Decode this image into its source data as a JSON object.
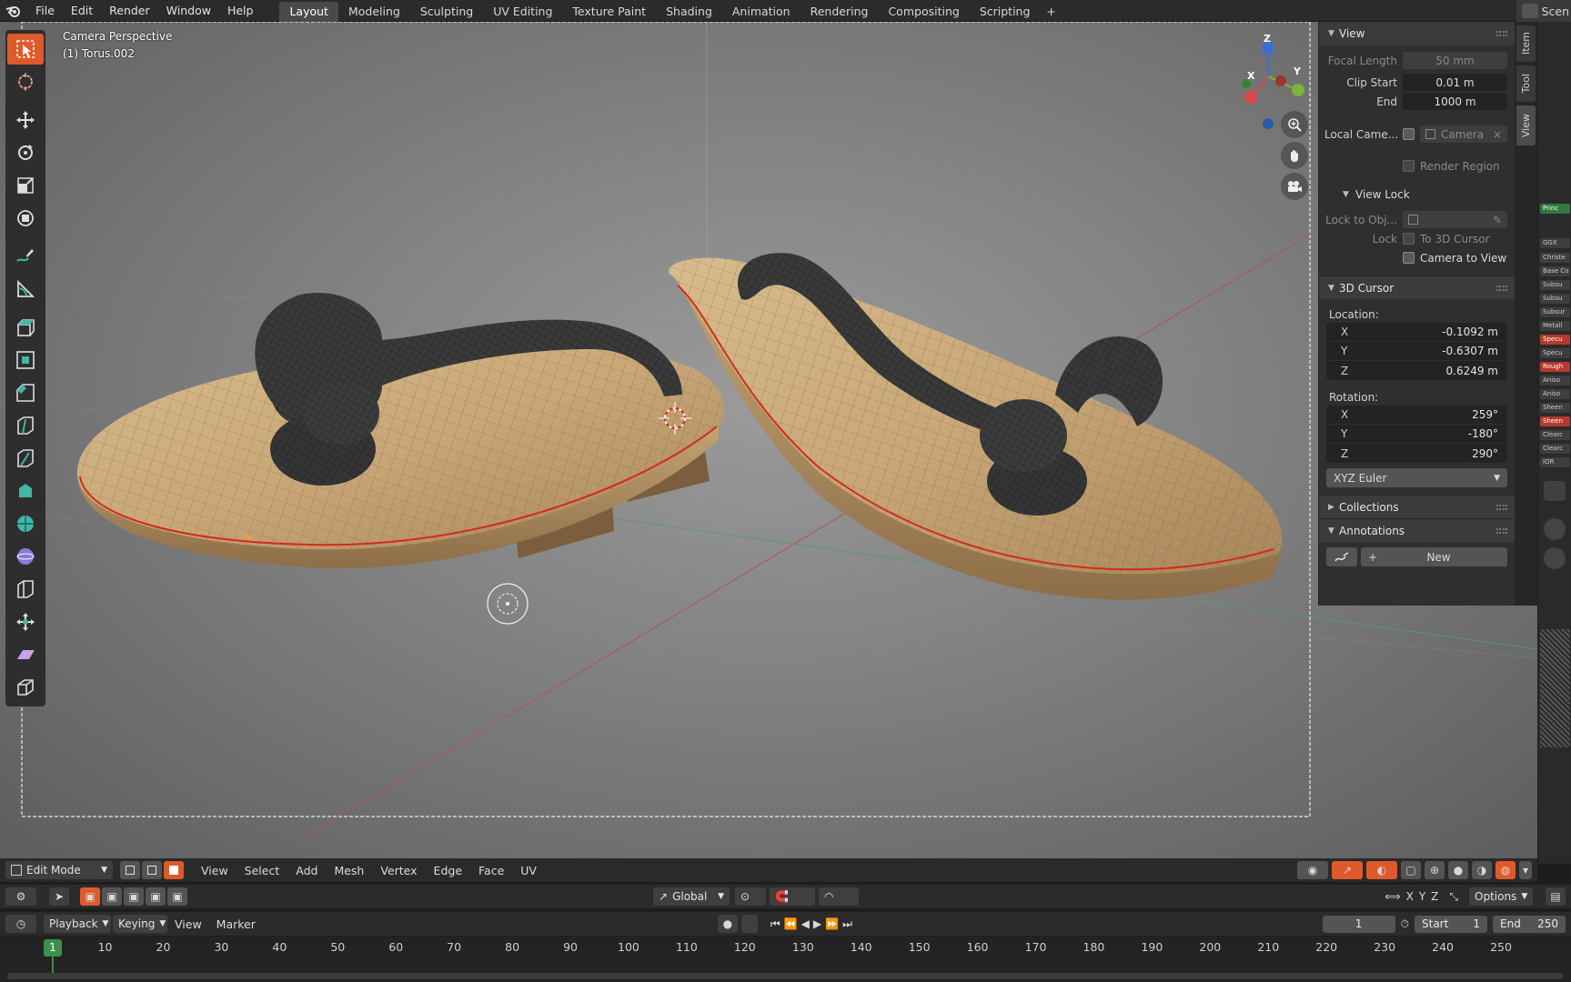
{
  "topbar": {
    "menus": [
      "File",
      "Edit",
      "Render",
      "Window",
      "Help"
    ],
    "workspaces": [
      "Layout",
      "Modeling",
      "Sculpting",
      "UV Editing",
      "Texture Paint",
      "Shading",
      "Animation",
      "Rendering",
      "Compositing",
      "Scripting"
    ],
    "active_workspace": "Layout",
    "scene_label": "Scen"
  },
  "viewport": {
    "view_name": "Camera Perspective",
    "object_name": "(1) Torus.002",
    "gizmo_axes": {
      "x": "X",
      "y": "Y",
      "z": "Z"
    }
  },
  "npanel": {
    "tabs": [
      "Item",
      "Tool",
      "View"
    ],
    "active_tab": "View",
    "view": {
      "header": "View",
      "focal_length_label": "Focal Length",
      "focal_length": "50 mm",
      "clip_start_label": "Clip Start",
      "clip_start": "0.01 m",
      "clip_end_label": "End",
      "clip_end": "1000 m",
      "local_camera_label": "Local Came...",
      "camera_field": "Camera",
      "render_region_label": "Render Region"
    },
    "view_lock": {
      "header": "View Lock",
      "lock_to_obj_label": "Lock to Obj...",
      "lock_label": "Lock",
      "to_3d_cursor": "To 3D Cursor",
      "camera_to_view": "Camera to View"
    },
    "cursor": {
      "header": "3D Cursor",
      "location_label": "Location:",
      "location": [
        {
          "axis": "X",
          "value": "-0.1092 m"
        },
        {
          "axis": "Y",
          "value": "-0.6307 m"
        },
        {
          "axis": "Z",
          "value": "0.6249 m"
        }
      ],
      "rotation_label": "Rotation:",
      "rotation": [
        {
          "axis": "X",
          "value": "259°"
        },
        {
          "axis": "Y",
          "value": "-180°"
        },
        {
          "axis": "Z",
          "value": "290°"
        }
      ],
      "rotation_mode": "XYZ Euler"
    },
    "collections_header": "Collections",
    "annotations_header": "Annotations",
    "new_button": "New"
  },
  "sidestrip": {
    "items": [
      "Princ",
      "GGX",
      "Christe",
      "Base Co",
      "Subsu",
      "Subsu",
      "Subsur",
      "Metall",
      "Specu",
      "Specu",
      "Rough",
      "Aniso",
      "Aniso",
      "Sheen",
      "Sheen",
      "Clearc",
      "Clearc",
      "IOR"
    ]
  },
  "vp_header": {
    "mode": "Edit Mode",
    "menus": [
      "View",
      "Select",
      "Add",
      "Mesh",
      "Vertex",
      "Edge",
      "Face",
      "UV"
    ]
  },
  "tool_header": {
    "transform_orientation": "Global",
    "axes": [
      "X",
      "Y",
      "Z"
    ],
    "options_label": "Options"
  },
  "timeline": {
    "playback_label": "Playback",
    "keying_label": "Keying",
    "view_label": "View",
    "marker_label": "Marker",
    "current_frame": "1",
    "start_label": "Start",
    "start": "1",
    "end_label": "End",
    "end": "250",
    "frame_ticks": [
      "10",
      "20",
      "30",
      "40",
      "50",
      "60",
      "70",
      "80",
      "90",
      "100",
      "110",
      "120",
      "130",
      "140",
      "150",
      "160",
      "170",
      "180",
      "190",
      "200",
      "210",
      "220",
      "230",
      "240",
      "250"
    ],
    "playhead_frame": "1"
  },
  "colors": {
    "accent": "#e0592a",
    "wood": "#c9a777",
    "strap": "#3a3a3a",
    "seam": "#d42a1c",
    "playhead": "#3d8f4a"
  }
}
